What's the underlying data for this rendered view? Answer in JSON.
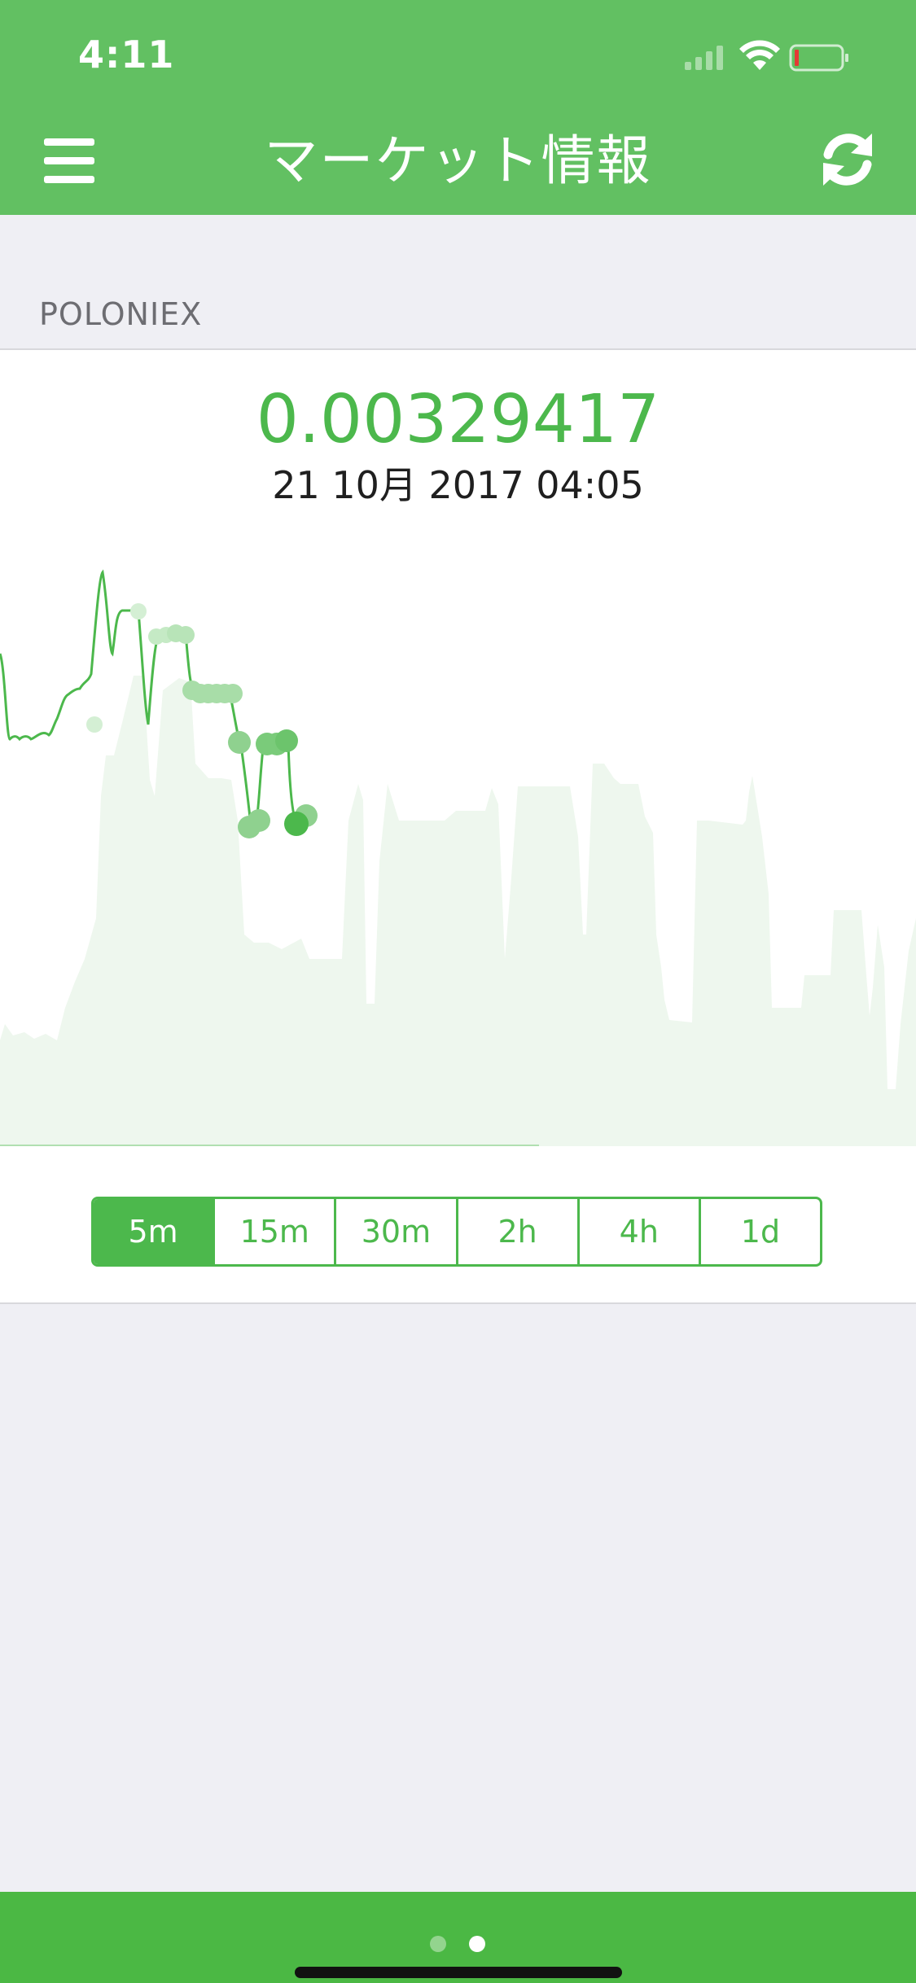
{
  "status_bar": {
    "time": "4:11"
  },
  "header": {
    "title": "マーケット情報",
    "menu_icon": "hamburger-icon",
    "refresh_icon": "refresh-icon"
  },
  "section": {
    "label": "POLONIEX"
  },
  "ticker": {
    "price": "0.00329417",
    "date": "21 10月 2017 04:05"
  },
  "intervals": {
    "selected": "5m",
    "options": [
      "5m",
      "15m",
      "30m",
      "2h",
      "4h",
      "1d"
    ]
  },
  "pager": {
    "pages": 2,
    "current": 2
  },
  "colors": {
    "header": "#62c062",
    "accent": "#4cb84c",
    "background": "#efeff4",
    "area_fill": "#eef7ee"
  }
}
